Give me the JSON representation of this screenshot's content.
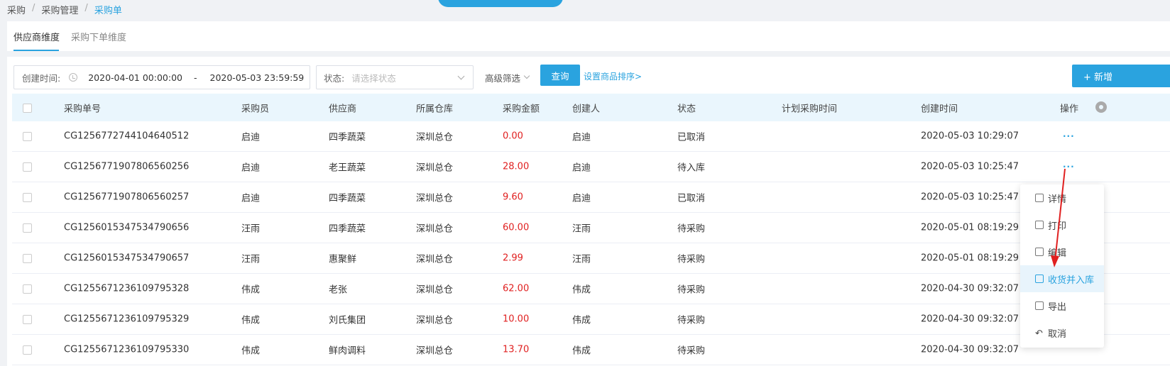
{
  "breadcrumb": [
    "采购",
    "采购管理",
    "采购单"
  ],
  "tabs": [
    {
      "label": "供应商维度"
    },
    {
      "label": "采购下单维度"
    }
  ],
  "filters": {
    "date_label": "创建时间:",
    "date_start": "2020-04-01 00:00:00",
    "date_sep": "-",
    "date_end": "2020-05-03 23:59:59",
    "status_label": "状态:",
    "status_placeholder": "请选择状态",
    "advanced": "高级筛选",
    "query": "查询",
    "sort_link": "设置商品排序>",
    "new_button": "+ 新增"
  },
  "table": {
    "headers": [
      "采购单号",
      "采购员",
      "供应商",
      "所属仓库",
      "采购金额",
      "创建人",
      "状态",
      "计划采购时间",
      "创建时间",
      "操作"
    ],
    "rows": [
      {
        "id": "CG1256772744104640512",
        "buyer": "启迪",
        "supplier": "四季蔬菜",
        "warehouse": "深圳总仓",
        "amount": "0.00",
        "creator": "启迪",
        "status": "已取消",
        "plan_time": "",
        "created": "2020-05-03 10:29:07"
      },
      {
        "id": "CG1256771907806560256",
        "buyer": "启迪",
        "supplier": "老王蔬菜",
        "warehouse": "深圳总仓",
        "amount": "28.00",
        "creator": "启迪",
        "status": "待入库",
        "plan_time": "",
        "created": "2020-05-03 10:25:47"
      },
      {
        "id": "CG1256771907806560257",
        "buyer": "启迪",
        "supplier": "四季蔬菜",
        "warehouse": "深圳总仓",
        "amount": "9.60",
        "creator": "启迪",
        "status": "已取消",
        "plan_time": "",
        "created": "2020-05-03 10:25:47"
      },
      {
        "id": "CG1256015347534790656",
        "buyer": "汪雨",
        "supplier": "四季蔬菜",
        "warehouse": "深圳总仓",
        "amount": "60.00",
        "creator": "汪雨",
        "status": "待采购",
        "plan_time": "",
        "created": "2020-05-01 08:19:29"
      },
      {
        "id": "CG1256015347534790657",
        "buyer": "汪雨",
        "supplier": "惠聚鲜",
        "warehouse": "深圳总仓",
        "amount": "2.99",
        "creator": "汪雨",
        "status": "待采购",
        "plan_time": "",
        "created": "2020-05-01 08:19:29"
      },
      {
        "id": "CG1255671236109795328",
        "buyer": "伟成",
        "supplier": "老张",
        "warehouse": "深圳总仓",
        "amount": "62.00",
        "creator": "伟成",
        "status": "待采购",
        "plan_time": "",
        "created": "2020-04-30 09:32:07"
      },
      {
        "id": "CG1255671236109795329",
        "buyer": "伟成",
        "supplier": "刘氏集团",
        "warehouse": "深圳总仓",
        "amount": "10.00",
        "creator": "伟成",
        "status": "待采购",
        "plan_time": "",
        "created": "2020-04-30 09:32:07"
      },
      {
        "id": "CG1255671236109795330",
        "buyer": "伟成",
        "supplier": "鲜肉调料",
        "warehouse": "深圳总仓",
        "amount": "13.70",
        "creator": "伟成",
        "status": "待采购",
        "plan_time": "",
        "created": "2020-04-30 09:32:07"
      }
    ],
    "ops_label": "···"
  },
  "menu": {
    "items": [
      {
        "label": "详情",
        "icon": "detail-icon"
      },
      {
        "label": "打印",
        "icon": "print-icon"
      },
      {
        "label": "编辑",
        "icon": "edit-icon"
      },
      {
        "label": "收货并入库",
        "icon": "receive-icon"
      },
      {
        "label": "导出",
        "icon": "export-icon"
      },
      {
        "label": "取消",
        "icon": "undo-icon"
      }
    ],
    "active_index": 3
  },
  "colors": {
    "accent": "#2aa3df",
    "amount": "#e02020",
    "arrow": "#e02020"
  }
}
